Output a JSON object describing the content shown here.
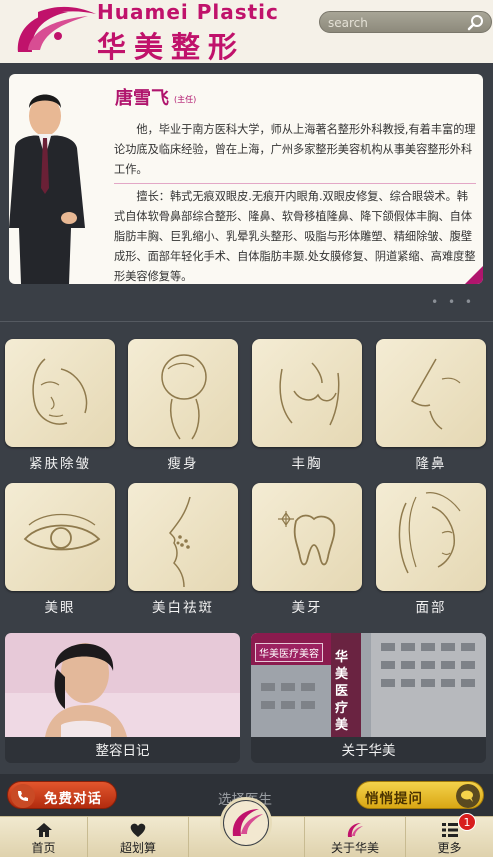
{
  "header": {
    "brand_en": "Huamei Plastic",
    "brand_cn": "华美整形",
    "search_placeholder": "search"
  },
  "banner": {
    "doctor_name": "唐雪飞",
    "doctor_title": "(主任)",
    "bio": "他，毕业于南方医科大学，师从上海著名整形外科教授,有着丰富的理论功底及临床经验，曾在上海，广州多家整形美容机构从事美容整形外科工作。",
    "skills": "擅长：韩式无痕双眼皮.无痕开内眼角.双眼皮修复、综合眼袋术。韩式自体软骨鼻部综合整形、隆鼻、软骨移植隆鼻、降下颌假体丰胸、自体脂肪丰胸、巨乳缩小、乳晕乳头整形、吸脂与形体雕塑、精细除皱、腹壁成形、面部年轻化手术、自体脂肪丰颞.处女膜修复、阴道紧缩、高难度整形美容修复等。",
    "slide_count": 2,
    "active_slide": 1
  },
  "services": [
    {
      "label": "紧肤除皱",
      "icon": "face-wrinkle-icon"
    },
    {
      "label": "瘦身",
      "icon": "slim-body-icon"
    },
    {
      "label": "丰胸",
      "icon": "breast-icon"
    },
    {
      "label": "隆鼻",
      "icon": "nose-icon"
    },
    {
      "label": "美眼",
      "icon": "eye-icon"
    },
    {
      "label": "美白祛斑",
      "icon": "skin-whitening-icon"
    },
    {
      "label": "美牙",
      "icon": "tooth-icon"
    },
    {
      "label": "面部",
      "icon": "face-icon"
    }
  ],
  "cards": [
    {
      "label": "整容日记"
    },
    {
      "label": "关于华美",
      "sign_text": "华美医疗美容",
      "building_text": "华美医疗美"
    }
  ],
  "action_bar": {
    "chat_label": "免费对话",
    "select_doctor": "选择医生",
    "ask_label": "悄悄提问"
  },
  "bottom_nav": [
    {
      "label": "首页"
    },
    {
      "label": "超划算"
    },
    {
      "label": "关于华美"
    },
    {
      "label": "更多"
    }
  ],
  "badge_count": "1",
  "colors": {
    "brand": "#c0126b",
    "background": "#3a3f46",
    "tile": "#efe4c6"
  }
}
